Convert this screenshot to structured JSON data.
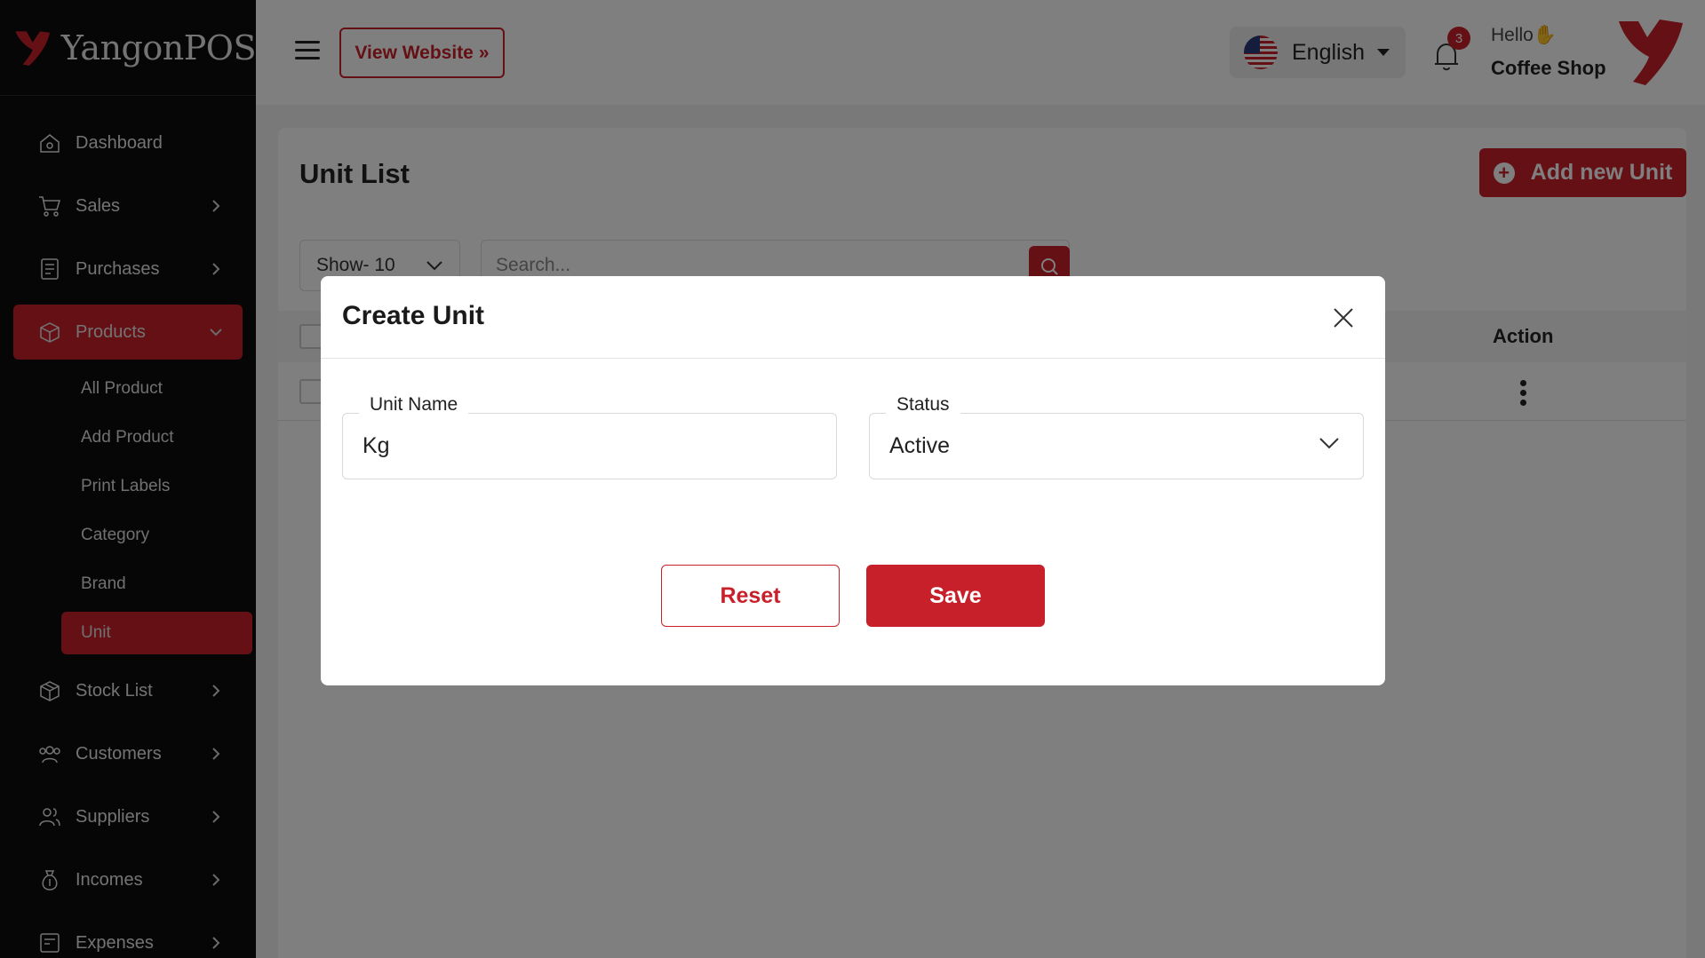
{
  "brand": {
    "name": "YangonPOS",
    "accent": "#c8202a"
  },
  "header": {
    "view_website": "View Website",
    "language": "English",
    "notifications_count": "3",
    "greeting": "Hello",
    "user_name": "Coffee Shop"
  },
  "sidebar": {
    "items": [
      {
        "label": "Dashboard",
        "icon": "home-icon"
      },
      {
        "label": "Sales",
        "icon": "cart-icon"
      },
      {
        "label": "Purchases",
        "icon": "receipt-icon"
      },
      {
        "label": "Products",
        "icon": "box-icon"
      },
      {
        "label": "Stock List",
        "icon": "package-icon"
      },
      {
        "label": "Customers",
        "icon": "users-icon"
      },
      {
        "label": "Suppliers",
        "icon": "user-group-icon"
      },
      {
        "label": "Incomes",
        "icon": "money-bag-icon"
      },
      {
        "label": "Expenses",
        "icon": "invoice-icon"
      }
    ],
    "products_sub": [
      "All Product",
      "Add Product",
      "Print Labels",
      "Category",
      "Brand",
      "Unit"
    ]
  },
  "main": {
    "title": "Unit List",
    "add_button": "Add new Unit",
    "show_select": "Show- 10",
    "search_placeholder": "Search...",
    "table_action_header": "Action"
  },
  "modal": {
    "title": "Create Unit",
    "unit_name_label": "Unit Name",
    "unit_name_value": "Kg",
    "status_label": "Status",
    "status_value": "Active",
    "reset_label": "Reset",
    "save_label": "Save"
  }
}
